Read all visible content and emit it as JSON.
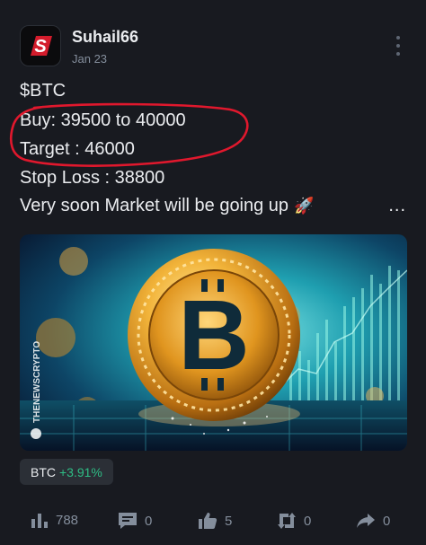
{
  "post": {
    "author": "Suhail66",
    "date": "Jan 23",
    "avatar_letter": "S",
    "lines": [
      "$BTC",
      "Buy: 39500 to 40000",
      "Target : 46000",
      "Stop Loss : 38800",
      "Very soon Market will be going up"
    ],
    "rocket": "🚀",
    "more_label": "...",
    "image": {
      "watermark": "THENEWSCRYPTO",
      "coin_symbol": "B"
    },
    "tag": {
      "symbol": "BTC",
      "change": "+3.91%"
    }
  },
  "actions": {
    "views": "788",
    "comments": "0",
    "likes": "5",
    "reposts": "0",
    "shares": "0"
  },
  "colors": {
    "background": "#181a20",
    "text": "#eaecef",
    "muted": "#848e9c",
    "positive": "#2ebd85",
    "annotation_red": "#e0182d"
  }
}
